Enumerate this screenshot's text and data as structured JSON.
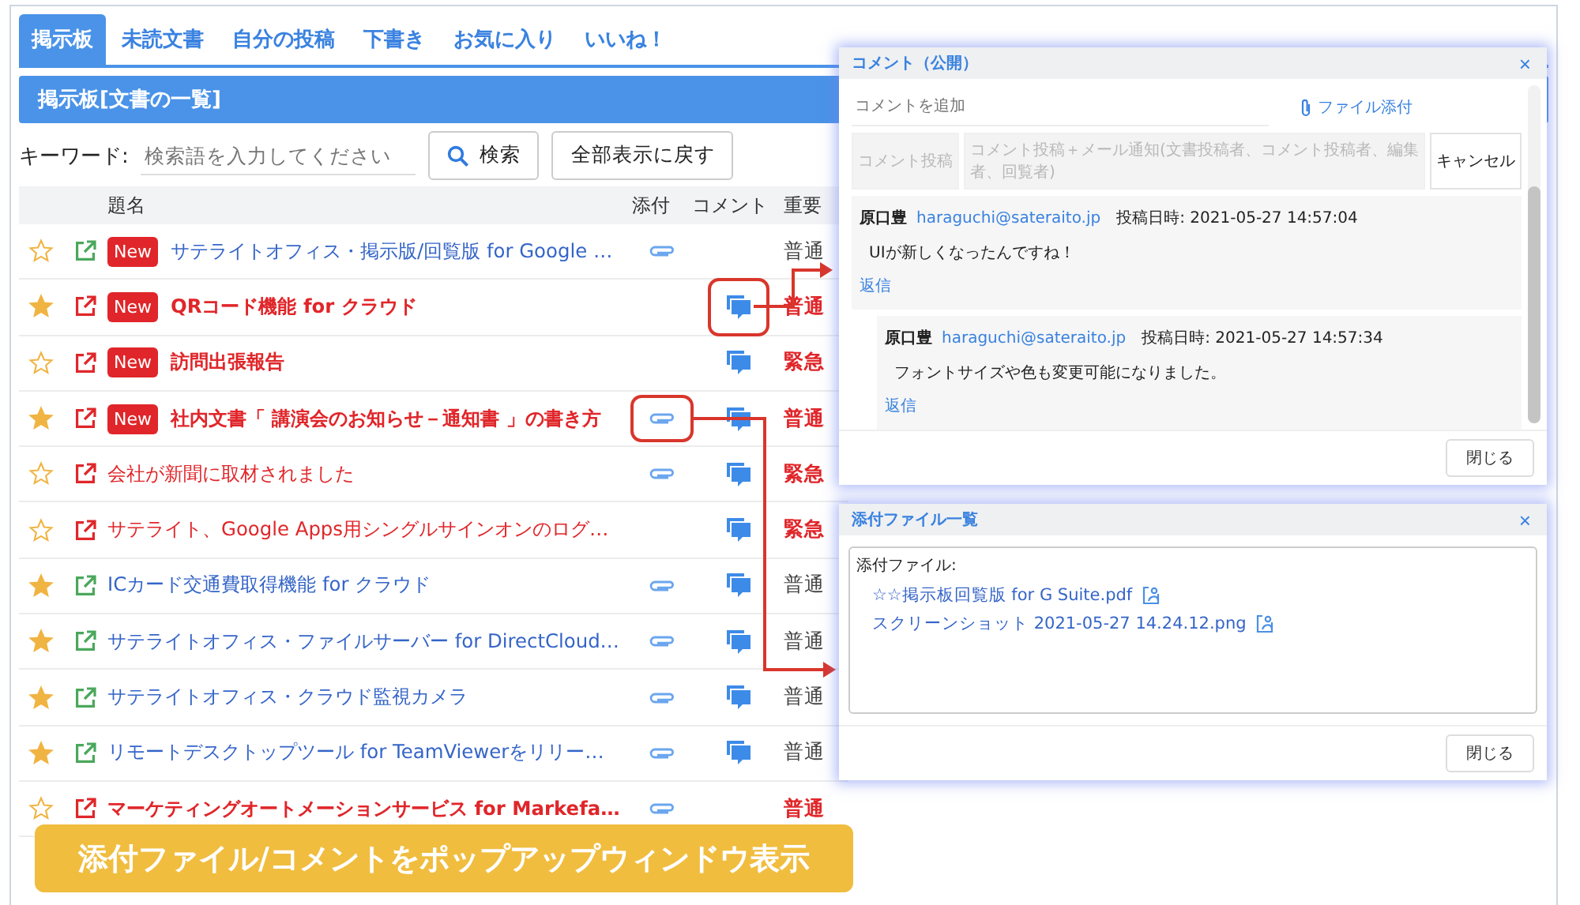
{
  "tabs": [
    {
      "label": "掲示板",
      "selected": true
    },
    {
      "label": "未読文書",
      "selected": false
    },
    {
      "label": "自分の投稿",
      "selected": false
    },
    {
      "label": "下書き",
      "selected": false
    },
    {
      "label": "お気に入り",
      "selected": false
    },
    {
      "label": "いいね！",
      "selected": false
    }
  ],
  "list_title": "掲示板[文書の一覧]",
  "search": {
    "label": "キーワード:",
    "placeholder": "検索語を入力してください",
    "search_button": "検索",
    "reset_button": "全部表示に戻す"
  },
  "table": {
    "columns": [
      "題名",
      "添付",
      "コメント",
      "重要"
    ],
    "rows": [
      {
        "starred": false,
        "alert": false,
        "bold": false,
        "badge": "New",
        "title": "サテライトオフィス・掲示版/回覧版 for Google …",
        "attachment": true,
        "comment": false,
        "importance": "普通"
      },
      {
        "starred": true,
        "alert": true,
        "bold": true,
        "badge": "New",
        "title": "QRコード機能 for クラウド",
        "attachment": false,
        "comment": true,
        "comment_highlighted": true,
        "importance": "普通"
      },
      {
        "starred": false,
        "alert": true,
        "bold": true,
        "badge": "New",
        "title": "訪問出張報告",
        "attachment": false,
        "comment": true,
        "importance": "緊急"
      },
      {
        "starred": true,
        "alert": true,
        "bold": true,
        "badge": "New",
        "title": "社内文書「 講演会のお知らせ－通知書 」の書き方",
        "attachment": true,
        "attachment_highlighted": true,
        "comment": true,
        "importance": "普通"
      },
      {
        "starred": false,
        "alert": true,
        "bold": false,
        "title": "会社が新聞に取材されました",
        "attachment": true,
        "comment": true,
        "importance": "緊急"
      },
      {
        "starred": false,
        "alert": true,
        "bold": false,
        "title": "サテライト、Google Apps用シングルサインオンのログ…",
        "attachment": false,
        "comment": true,
        "importance": "緊急"
      },
      {
        "starred": true,
        "alert": false,
        "bold": false,
        "title": "ICカード交通費取得機能 for クラウド",
        "attachment": true,
        "comment": true,
        "importance": "普通"
      },
      {
        "starred": true,
        "alert": false,
        "bold": false,
        "title": "サテライトオフィス・ファイルサーバー for DirectCloud…",
        "attachment": true,
        "comment": true,
        "importance": "普通"
      },
      {
        "starred": true,
        "alert": false,
        "bold": false,
        "title": "サテライトオフィス・クラウド監視カメラ",
        "attachment": true,
        "comment": true,
        "importance": "普通"
      },
      {
        "starred": true,
        "alert": false,
        "bold": false,
        "title": "リモートデスクトップツール for TeamViewerをリリー…",
        "attachment": true,
        "comment": true,
        "importance": "普通"
      },
      {
        "starred": false,
        "alert": true,
        "bold": true,
        "title": "マーケティングオートメーションサービス for Markefa…",
        "attachment": true,
        "comment": false,
        "importance": "普通"
      }
    ]
  },
  "comment_popup": {
    "title": "コメント（公開）",
    "close": "×",
    "placeholder": "コメントを追加",
    "attach_link": "ファイル添付",
    "buttons": [
      {
        "label": "コメント投稿",
        "disabled": true
      },
      {
        "label": "コメント投稿＋メール通知(文書投稿者、コメント投稿者、編集者、回覧者)",
        "disabled": true
      },
      {
        "label": "キャンセル",
        "disabled": false
      }
    ],
    "comments": [
      {
        "author": "原口豊",
        "email": "haraguchi@sateraito.jp",
        "posted": "投稿日時: 2021-05-27 14:57:04",
        "body": "UIが新しくなったんですね！",
        "reply": "返信",
        "children": [
          {
            "author": "原口豊",
            "email": "haraguchi@sateraito.jp",
            "posted": "投稿日時: 2021-05-27 14:57:34",
            "body": "フォントサイズや色も変更可能になりました。",
            "reply": "返信"
          }
        ]
      }
    ],
    "close_button": "閉じる"
  },
  "attachment_popup": {
    "title": "添付ファイル一覧",
    "close": "×",
    "label": "添付ファイル:",
    "files": [
      "☆☆掲示板回覧版 for G Suite.pdf",
      "スクリーンショット 2021-05-27 14.24.12.png"
    ],
    "close_button": "閉じる"
  },
  "banner": "添付ファイル/コメントをポップアップウィンドウ表示"
}
